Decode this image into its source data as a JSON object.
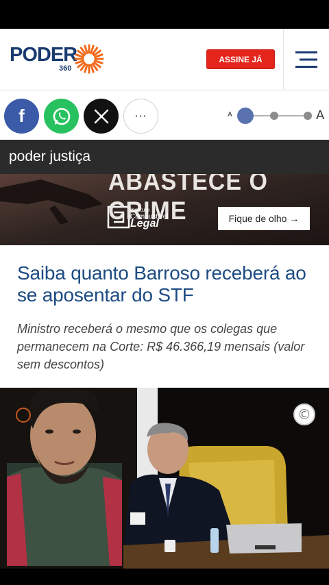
{
  "header": {
    "logo_word": "PODER",
    "logo_number": "360",
    "subscribe_label": "ASSINE JÁ"
  },
  "sharebar": {
    "facebook_glyph": "f",
    "x_glyph": "𝕏",
    "more_glyph": "···",
    "font_small_label": "A",
    "font_large_label": "A",
    "font_size_level": 0.0
  },
  "section": {
    "title": "poder justiça"
  },
  "ad_banner": {
    "headline": "ABASTECE O CRIME",
    "sponsor_line1": "Instituto",
    "sponsor_line2": "Combustível",
    "sponsor_line3": "Legal",
    "cta_label": "Fique de olho →"
  },
  "article": {
    "headline": "Saiba quanto Barroso receberá ao se aposentar do STF",
    "subheadline": "Ministro receberá o mesmo que os colegas que permanecem na Corte: R$ 46.366,19 mensais (valor sem descontos)"
  },
  "photo": {
    "copyright_symbol": "©"
  },
  "colors": {
    "brand_navy": "#1a3b70",
    "brand_orange": "#f26a1b",
    "subscribe_red": "#e3251c",
    "headline_blue": "#1d4c83",
    "section_bar": "#2b2b2b",
    "facebook": "#3b5ba8",
    "whatsapp": "#27c25f",
    "slider_knob": "#5a73b0"
  },
  "icons": [
    "sun-logo-icon",
    "hamburger-menu-icon",
    "facebook-icon",
    "whatsapp-icon",
    "x-icon",
    "more-icon",
    "copyright-icon",
    "gun-icon",
    "arrow-right-icon"
  ]
}
